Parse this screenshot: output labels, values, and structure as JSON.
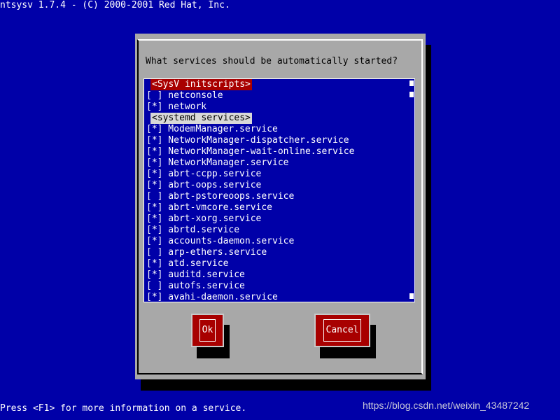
{
  "top_title": "ntsysv 1.7.4 - (C) 2000-2001 Red Hat, Inc.",
  "bottom_help": "Press <F1> for more information on a service.",
  "watermark": "https://blog.csdn.net/weixin_43487242",
  "dialog": {
    "prompt": "What services should be automatically started?",
    "ok_label": "Ok",
    "cancel_label": "Cancel"
  },
  "colors": {
    "background": "#0000a8",
    "dialog": "#a8a8a8",
    "button": "#a80000",
    "sysv_header": "#a80000",
    "systemd_header": "#d8d8d8"
  },
  "sections": {
    "sysv_header": "<SysV initscripts>",
    "systemd_header": "<systemd services>"
  },
  "services": [
    {
      "mark": "[ ]",
      "name": "netconsole"
    },
    {
      "mark": "[*]",
      "name": "network"
    },
    {
      "mark": "[*]",
      "name": "ModemManager.service"
    },
    {
      "mark": "[*]",
      "name": "NetworkManager-dispatcher.service"
    },
    {
      "mark": "[*]",
      "name": "NetworkManager-wait-online.service"
    },
    {
      "mark": "[*]",
      "name": "NetworkManager.service"
    },
    {
      "mark": "[*]",
      "name": "abrt-ccpp.service"
    },
    {
      "mark": "[*]",
      "name": "abrt-oops.service"
    },
    {
      "mark": "[ ]",
      "name": "abrt-pstoreoops.service"
    },
    {
      "mark": "[*]",
      "name": "abrt-vmcore.service"
    },
    {
      "mark": "[*]",
      "name": "abrt-xorg.service"
    },
    {
      "mark": "[*]",
      "name": "abrtd.service"
    },
    {
      "mark": "[*]",
      "name": "accounts-daemon.service"
    },
    {
      "mark": "[ ]",
      "name": "arp-ethers.service"
    },
    {
      "mark": "[*]",
      "name": "atd.service"
    },
    {
      "mark": "[*]",
      "name": "auditd.service"
    },
    {
      "mark": "[ ]",
      "name": "autofs.service"
    },
    {
      "mark": "[*]",
      "name": "avahi-daemon.service"
    }
  ]
}
